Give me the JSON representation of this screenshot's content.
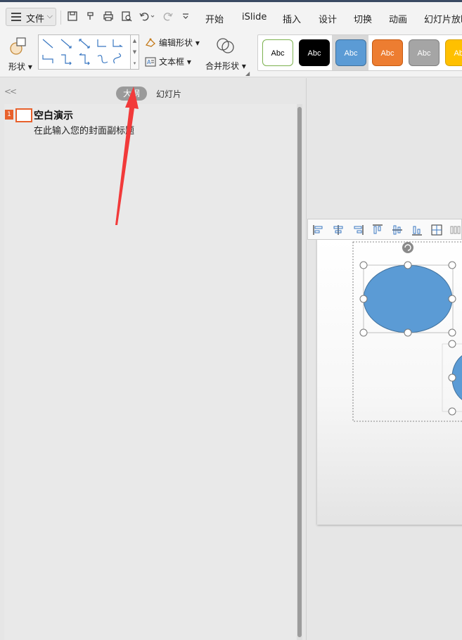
{
  "menubar": {
    "file_label": "文件",
    "tabs": [
      "开始",
      "iSlide",
      "插入",
      "设计",
      "切换",
      "动画",
      "幻灯片放映"
    ]
  },
  "ribbon": {
    "shape_label": "形状",
    "edit_shape_label": "编辑形状",
    "textbox_label": "文本框",
    "merge_shape_label": "合并形状",
    "style_presets": [
      {
        "label": "Abc",
        "bg": "#ffffff",
        "fg": "#000000",
        "border": "#7cb24f"
      },
      {
        "label": "Abc",
        "bg": "#000000",
        "fg": "#ffffff",
        "border": "#000000"
      },
      {
        "label": "Abc",
        "bg": "#5b9bd5",
        "fg": "#ffffff",
        "border": "#41719c"
      },
      {
        "label": "Abc",
        "bg": "#ed7d31",
        "fg": "#ffffff",
        "border": "#c55a11"
      },
      {
        "label": "Abc",
        "bg": "#a5a5a5",
        "fg": "#ffffff",
        "border": "#7f7f7f"
      },
      {
        "label": "Abc",
        "bg": "#ffc000",
        "fg": "#ffffff",
        "border": "#d6a100"
      }
    ]
  },
  "panel": {
    "tab_outline": "大纲",
    "tab_slides": "幻灯片",
    "slide_number": "1",
    "slide_title": "空白演示",
    "slide_subtitle": "在此输入您的封面副标题"
  },
  "colors": {
    "accent": "#e8612c",
    "ellipse_fill": "#5b9bd5",
    "arrow": "#f23a3a"
  }
}
